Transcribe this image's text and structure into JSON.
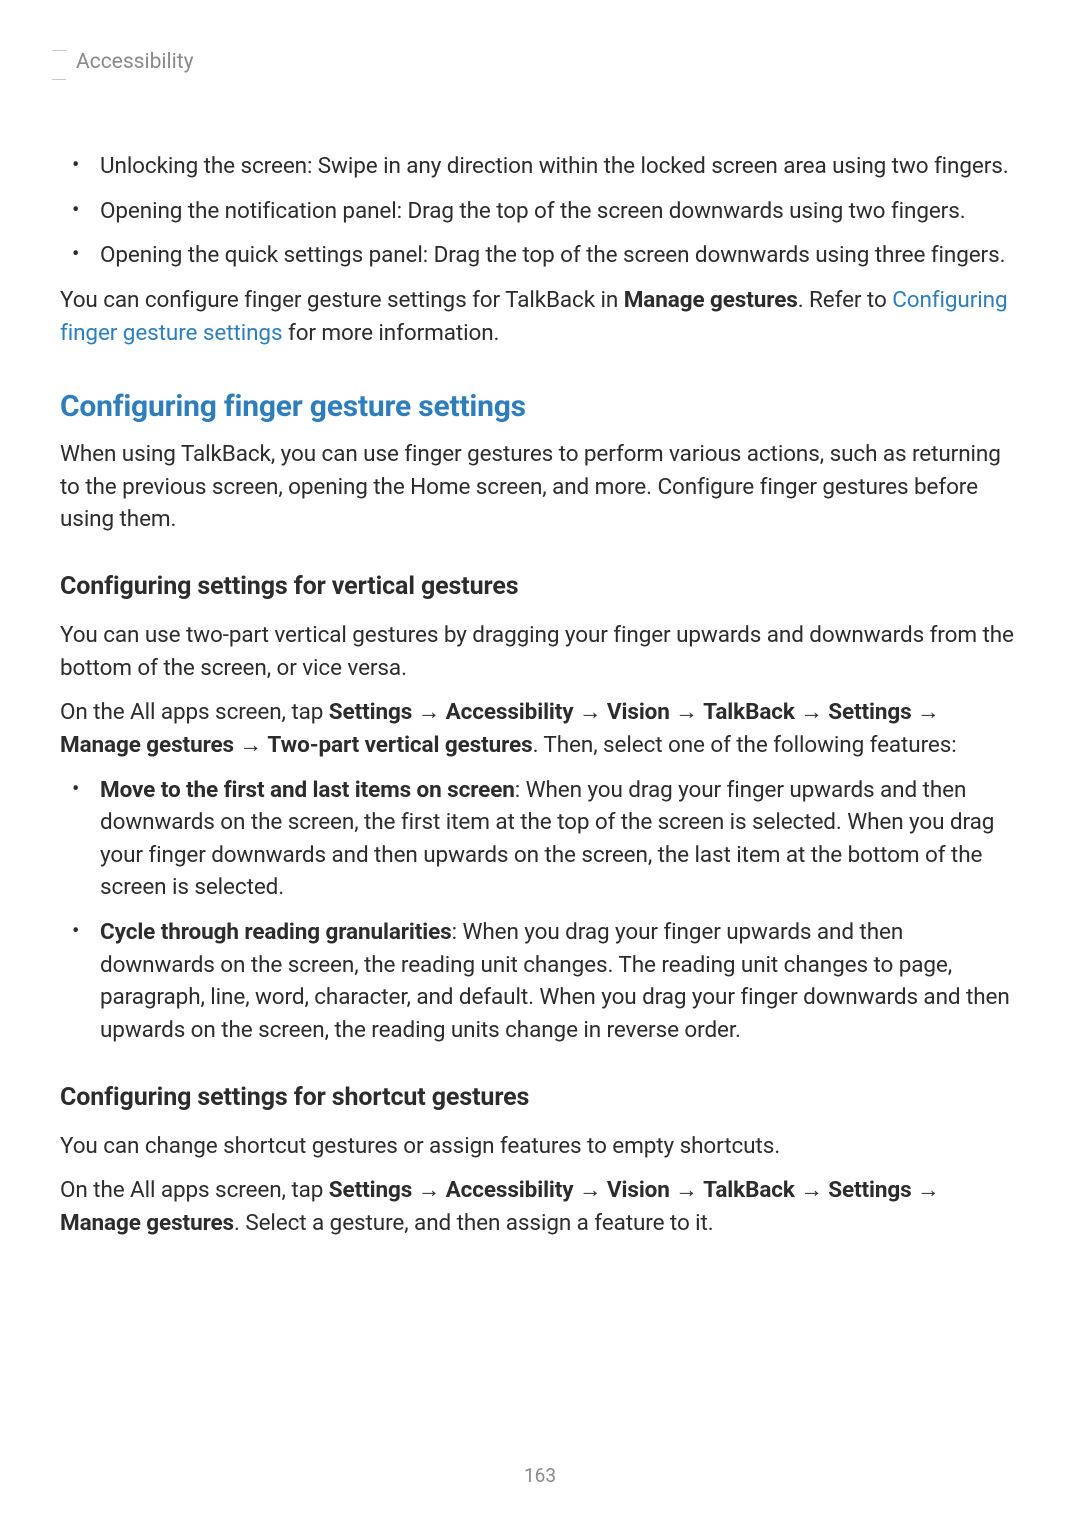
{
  "header": {
    "title": "Accessibility"
  },
  "arrow": "→",
  "top_bullets": [
    "Unlocking the screen: Swipe in any direction within the locked screen area using two fingers.",
    "Opening the notification panel: Drag the top of the screen downwards using two fingers.",
    "Opening the quick settings panel: Drag the top of the screen downwards using three fingers."
  ],
  "top_para": {
    "pre": "You can configure finger gesture settings for TalkBack in ",
    "bold": "Manage gestures",
    "mid": ". Refer to ",
    "link": "Configuring finger gesture settings",
    "post": " for more information."
  },
  "section": {
    "title": "Configuring finger gesture settings",
    "intro": "When using TalkBack, you can use finger gestures to perform various actions, such as returning to the previous screen, opening the Home screen, and more. Configure finger gestures before using them."
  },
  "sub1": {
    "title": "Configuring settings for vertical gestures",
    "intro": "You can use two-part vertical gestures by dragging your finger upwards and downwards from the bottom of the screen, or vice versa.",
    "path": {
      "pre": "On the All apps screen, tap ",
      "steps": [
        "Settings",
        "Accessibility",
        "Vision",
        "TalkBack",
        "Settings",
        "Manage gestures",
        "Two-part vertical gestures"
      ],
      "post": ". Then, select one of the following features:"
    },
    "bullets": [
      {
        "bold": "Move to the first and last items on screen",
        "text": ": When you drag your finger upwards and then downwards on the screen, the first item at the top of the screen is selected. When you drag your finger downwards and then upwards on the screen, the last item at the bottom of the screen is selected."
      },
      {
        "bold": "Cycle through reading granularities",
        "text": ": When you drag your finger upwards and then downwards on the screen, the reading unit changes. The reading unit changes to page, paragraph, line, word, character, and default. When you drag your finger downwards and then upwards on the screen, the reading units change in reverse order."
      }
    ]
  },
  "sub2": {
    "title": "Configuring settings for shortcut gestures",
    "intro": "You can change shortcut gestures or assign features to empty shortcuts.",
    "path": {
      "pre": "On the All apps screen, tap ",
      "steps": [
        "Settings",
        "Accessibility",
        "Vision",
        "TalkBack",
        "Settings",
        "Manage gestures"
      ],
      "post": ". Select a gesture, and then assign a feature to it."
    }
  },
  "page_number": "163"
}
